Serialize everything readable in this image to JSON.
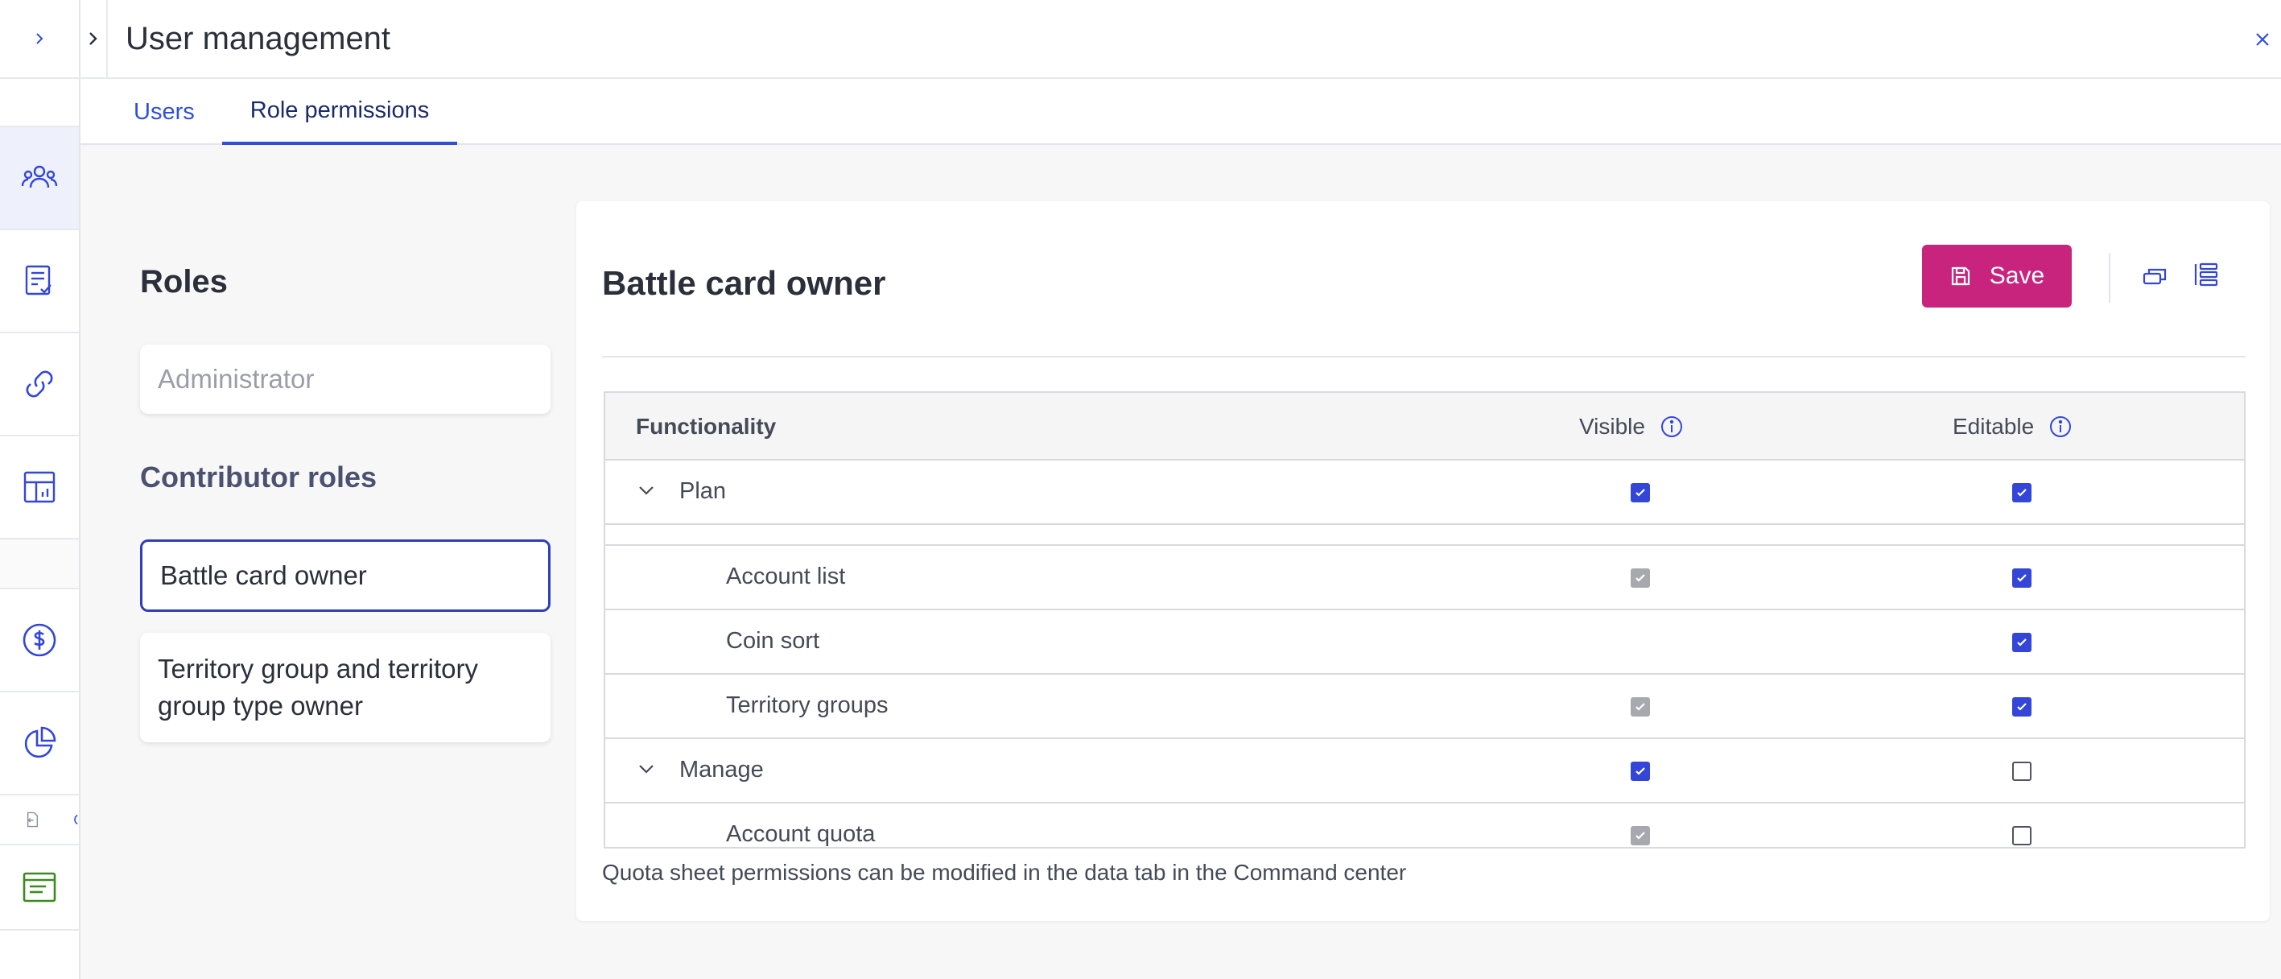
{
  "window": {
    "title": "User management"
  },
  "tabs": [
    {
      "label": "Users"
    },
    {
      "label": "Role permissions"
    }
  ],
  "roles": {
    "heading": "Roles",
    "admin_label": "Administrator",
    "contributor_heading": "Contributor roles",
    "contributor_roles": [
      {
        "label": "Battle card owner"
      },
      {
        "label": "Territory group and territory group type owner"
      }
    ]
  },
  "panel": {
    "title": "Battle card owner",
    "save_label": "Save",
    "table": {
      "headers": {
        "functionality": "Functionality",
        "visible": "Visible",
        "editable": "Editable"
      },
      "rows": [
        {
          "label": "Plan",
          "group": true,
          "visible": "checked",
          "editable": "checked"
        },
        {
          "label": "Account list",
          "group": false,
          "visible": "checked-disabled",
          "editable": "checked"
        },
        {
          "label": "Coin sort",
          "group": false,
          "visible": "none",
          "editable": "checked"
        },
        {
          "label": "Territory groups",
          "group": false,
          "visible": "checked-disabled",
          "editable": "checked"
        },
        {
          "label": "Manage",
          "group": true,
          "visible": "checked",
          "editable": "unchecked"
        },
        {
          "label": "Account quota",
          "group": false,
          "visible": "checked-disabled",
          "editable": "unchecked"
        }
      ]
    },
    "footnote": "Quota sheet permissions can be modified in the data tab in the Command center"
  },
  "colors": {
    "accent": "#2f4fd8",
    "save_button": "#c9247d",
    "checkbox_checked": "#3346d8",
    "checkbox_disabled": "#a7a9ae"
  },
  "icons": {
    "rail": [
      "chevron-right-icon",
      "users-icon",
      "checklist-icon",
      "link-icon",
      "dashboard-icon",
      "dollar-icon",
      "pie-chart-icon",
      "file-import-icon",
      "list-icon"
    ],
    "header": [
      "chevron-right-icon",
      "close-icon"
    ],
    "toolbar": [
      "save-icon",
      "collapse-all-icon",
      "expand-all-icon"
    ]
  }
}
